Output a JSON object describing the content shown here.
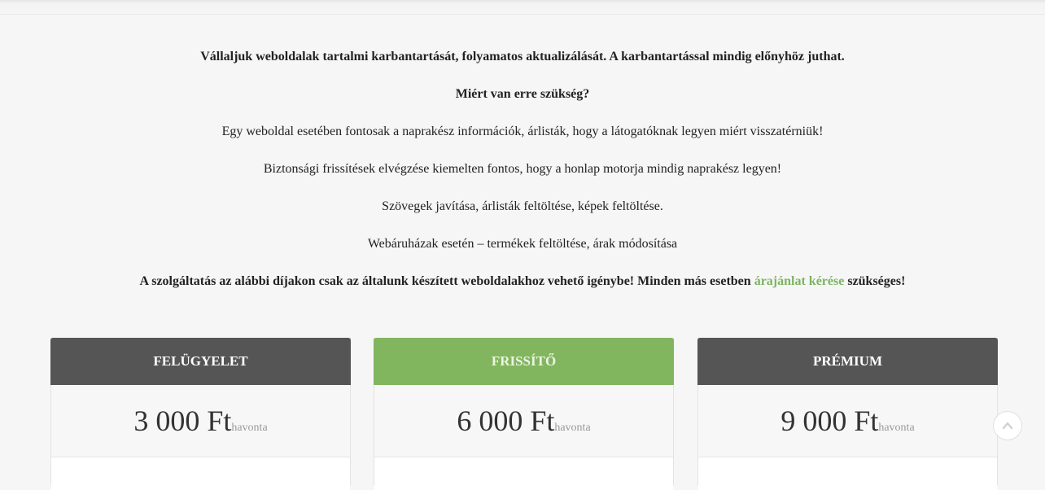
{
  "intro": {
    "line1": "Vállaljuk weboldalak tartalmi karbantartását, folyamatos aktualizálását. A karbantartással mindig előnyhöz juthat.",
    "line2": "Miért van erre szükség?",
    "line3": "Egy weboldal esetében fontosak a naprakész információk, árlisták, hogy a látogatóknak legyen miért visszatérniük!",
    "line4": "Biztonsági frissítések elvégzése kiemelten fontos, hogy a honlap motorja mindig naprakész legyen!",
    "line5": "Szövegek javítása, árlisták feltöltése, képek feltöltése.",
    "line6": "Webáruházak esetén – termékek feltöltése, árak módosítása",
    "line7_before": "A szolgáltatás az alábbi díjakon csak az általunk készített weboldalakhoz vehető igénybe! Minden más esetben ",
    "line7_link": "árajánlat kérése",
    "line7_after": " szükséges!"
  },
  "plans": [
    {
      "name": "FELÜGYELET",
      "price": "3 000 Ft",
      "period": "havonta",
      "header_color": "#555555"
    },
    {
      "name": "FRISSÍTŐ",
      "price": "6 000 Ft",
      "period": "havonta",
      "header_color": "#82b65e"
    },
    {
      "name": "PRÉMIUM",
      "price": "9 000 Ft",
      "period": "havonta",
      "header_color": "#555555"
    }
  ],
  "scroll_top": {
    "icon": "chevron-up-icon"
  }
}
